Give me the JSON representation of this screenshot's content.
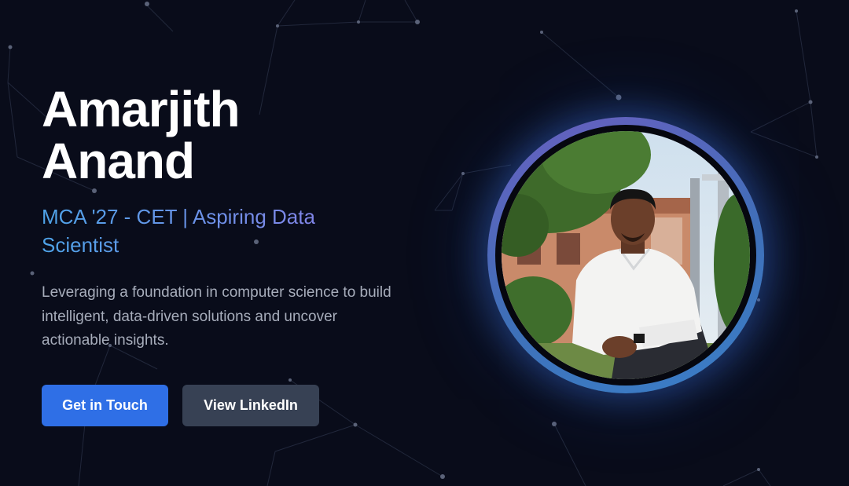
{
  "hero": {
    "name_line1": "Amarjith",
    "name_line2": "Anand",
    "tagline": "MCA '27 - CET | Aspiring Data Scientist",
    "description": "Leveraging a foundation in computer science to build intelligent, data-driven solutions and uncover actionable insights."
  },
  "buttons": {
    "primary_label": "Get in Touch",
    "secondary_label": "View LinkedIn"
  },
  "colors": {
    "background": "#090c1a",
    "primary_button": "#2f6fe6",
    "secondary_button": "#374154",
    "tagline_start": "#4ea3e8",
    "tagline_end": "#8b7fe8"
  },
  "avatar": {
    "icon": "profile-photo"
  }
}
